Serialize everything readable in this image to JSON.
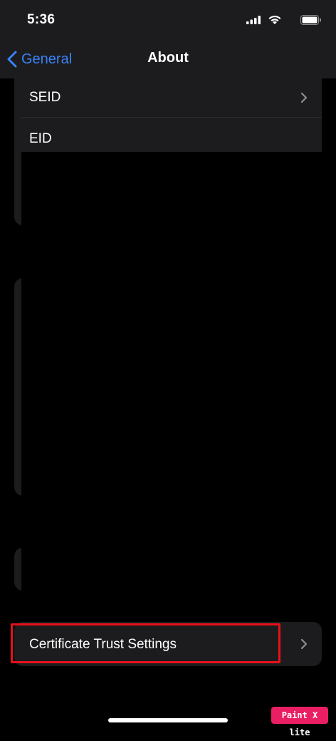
{
  "status_bar": {
    "time": "5:36",
    "icons": [
      "signal-icon",
      "wifi-icon",
      "battery-icon"
    ]
  },
  "nav": {
    "back_label": "General",
    "title": "About",
    "accent_color": "#3a82f7"
  },
  "rows": {
    "seid_label": "SEID",
    "eid_label": "EID",
    "cert_label": "Certificate Trust Settings"
  },
  "annotation": {
    "highlight_color": "#e8101b"
  },
  "watermark": {
    "text": "Paint X lite"
  }
}
